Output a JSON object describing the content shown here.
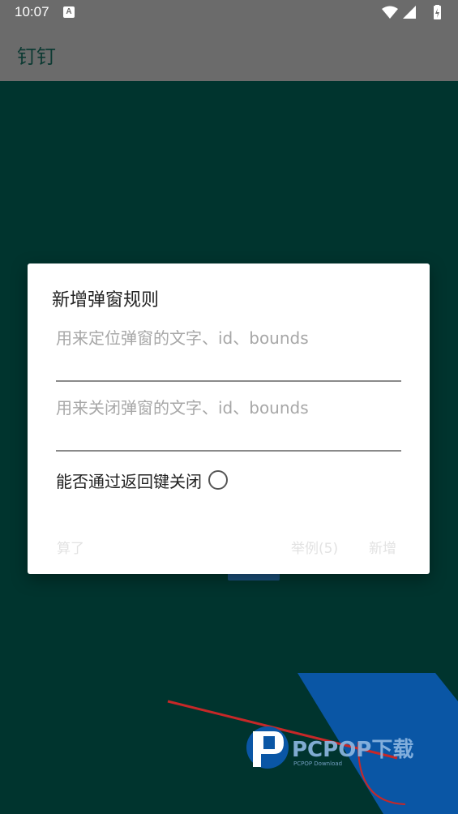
{
  "status_bar": {
    "time": "10:07",
    "notification_badge": "A",
    "icons": [
      "wifi-icon",
      "signal-icon",
      "battery-charging-icon"
    ]
  },
  "app_bar": {
    "title": "钉钉"
  },
  "dialog": {
    "title": "新增弹窗规则",
    "locate_field": {
      "value": "",
      "placeholder": "用来定位弹窗的文字、id、bounds"
    },
    "close_field": {
      "value": "",
      "placeholder": "用来关闭弹窗的文字、id、bounds"
    },
    "back_close_label": "能否通过返回键关闭",
    "back_close_checked": false,
    "buttons": {
      "cancel": "算了",
      "example": "举例(5)",
      "add": "新增"
    }
  },
  "watermark": {
    "brand": "PCPOP下载",
    "sub": "PCPOP Download"
  },
  "colors": {
    "background": "#00342e",
    "appbar": "#6b6b6b",
    "dialog": "#ffffff",
    "watermark_blue": "#0a56a5"
  }
}
